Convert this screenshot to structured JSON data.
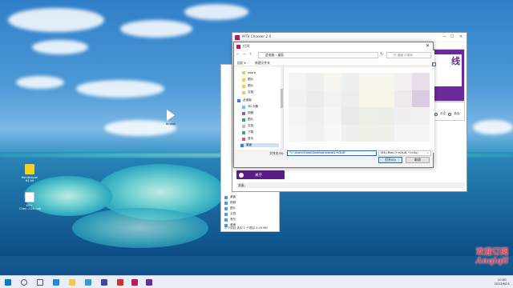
{
  "desktop": {
    "icons": [
      {
        "label": "Rombrayoh 64 bit",
        "icon": "app-icon"
      },
      {
        "label": "MTV-Chec...020.0eb",
        "icon": "doc-icon"
      },
      {
        "label": "Anqiqii",
        "icon": "video-icon"
      }
    ]
  },
  "app": {
    "title": "MTV Checker 2.0",
    "banner_text": "线",
    "about_label": "关于",
    "status_text": "准备。",
    "option_text": "中文",
    "option_text2": "英文"
  },
  "explorer_bg": {
    "items": [
      "桌面",
      "3D 对象",
      "视频",
      "图片",
      "文档",
      "下载",
      "音乐",
      "桌面"
    ],
    "status": "2 个项目    选中 1 个项目  3.09 MB"
  },
  "dialog": {
    "title": "打开",
    "address": "此电脑  ›  桌面",
    "search_placeholder": "在 桌面 中搜索",
    "toolbar": {
      "organize": "组织 ▾",
      "new_folder": "新建文件夹"
    },
    "nav_items": [
      {
        "label": "share",
        "icon": "folder-icon"
      },
      {
        "label": "图片",
        "icon": "folder-icon"
      },
      {
        "label": "图片",
        "icon": "folder-icon"
      },
      {
        "label": "文档",
        "icon": "folder-icon"
      },
      {
        "label": "此电脑",
        "icon": "pc-icon"
      },
      {
        "label": "3D 对象",
        "icon": "3d-icon"
      },
      {
        "label": "视频",
        "icon": "video-icon"
      },
      {
        "label": "图片",
        "icon": "picture-icon"
      },
      {
        "label": "文档",
        "icon": "doc-icon"
      },
      {
        "label": "下载",
        "icon": "download-icon"
      },
      {
        "label": "音乐",
        "icon": "music-icon"
      },
      {
        "label": "桌面",
        "icon": "desktop-icon"
      }
    ],
    "filename_label": "文件名(N):",
    "filename_value": "\"C:\\Users\\Fuwp\\Desktop\\sdsdd1.m3u8\"",
    "filter_value": "M3u files (*.m3u8, *.m3u)",
    "open_label": "打开(O)",
    "cancel_label": "取消"
  },
  "taskbar": {
    "time": "10:00",
    "date": "2023/6/21"
  },
  "watermark": {
    "line1": "欢迎订阅",
    "line2": "Anqiqii"
  },
  "colors": {
    "accent_purple": "#5b1e87",
    "brand_magenta": "#c2185b",
    "focus_blue": "#0078d4"
  }
}
